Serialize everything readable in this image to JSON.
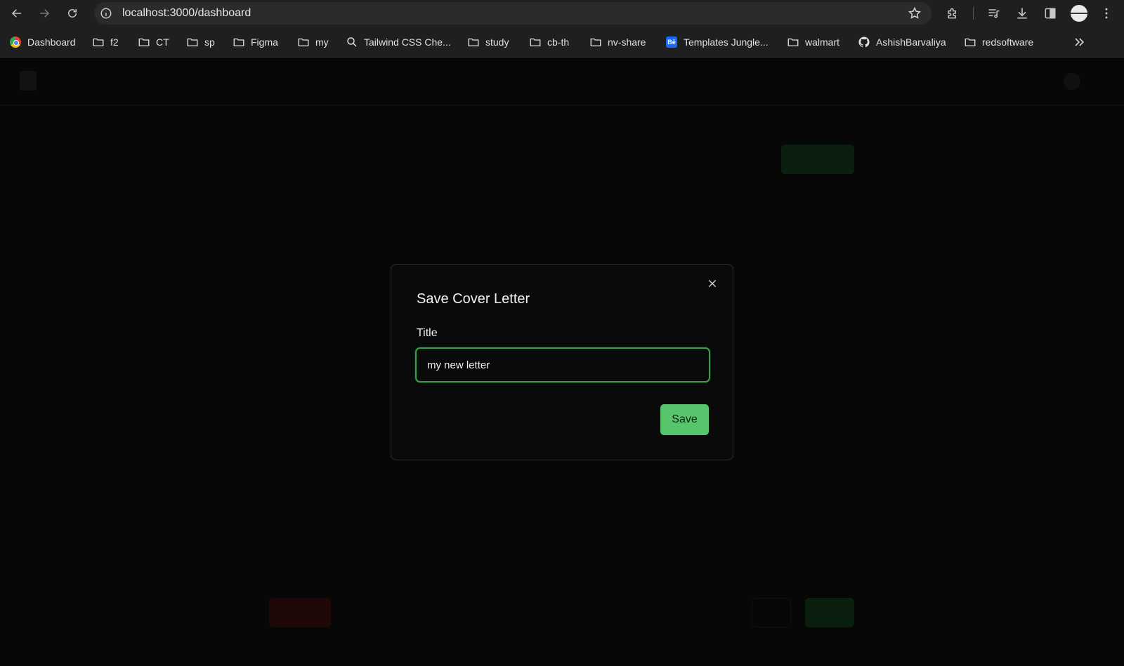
{
  "browser": {
    "url": "localhost:3000/dashboard",
    "bookmarks": [
      {
        "label": "Dashboard",
        "icon": "dashboard-favicon"
      },
      {
        "label": "f2",
        "icon": "folder-icon"
      },
      {
        "label": "CT",
        "icon": "folder-icon"
      },
      {
        "label": "sp",
        "icon": "folder-icon"
      },
      {
        "label": "Figma",
        "icon": "folder-icon"
      },
      {
        "label": "my",
        "icon": "folder-icon"
      },
      {
        "label": "Tailwind CSS Che...",
        "icon": "search-favicon"
      },
      {
        "label": "study",
        "icon": "folder-icon"
      },
      {
        "label": "cb-th",
        "icon": "folder-icon"
      },
      {
        "label": "nv-share",
        "icon": "folder-icon"
      },
      {
        "label": "Templates Jungle...",
        "icon": "behance-favicon"
      },
      {
        "label": "walmart",
        "icon": "folder-icon"
      },
      {
        "label": "AshishBarvaliya",
        "icon": "github-favicon"
      },
      {
        "label": "redsoftware",
        "icon": "folder-icon"
      }
    ]
  },
  "modal": {
    "title": "Save Cover Letter",
    "field_label": "Title",
    "input_value": "my new letter",
    "save_label": "Save"
  },
  "colors": {
    "accent": "#58c46c",
    "focus_ring": "#3a9d4a",
    "background": "#0a0a0a"
  }
}
